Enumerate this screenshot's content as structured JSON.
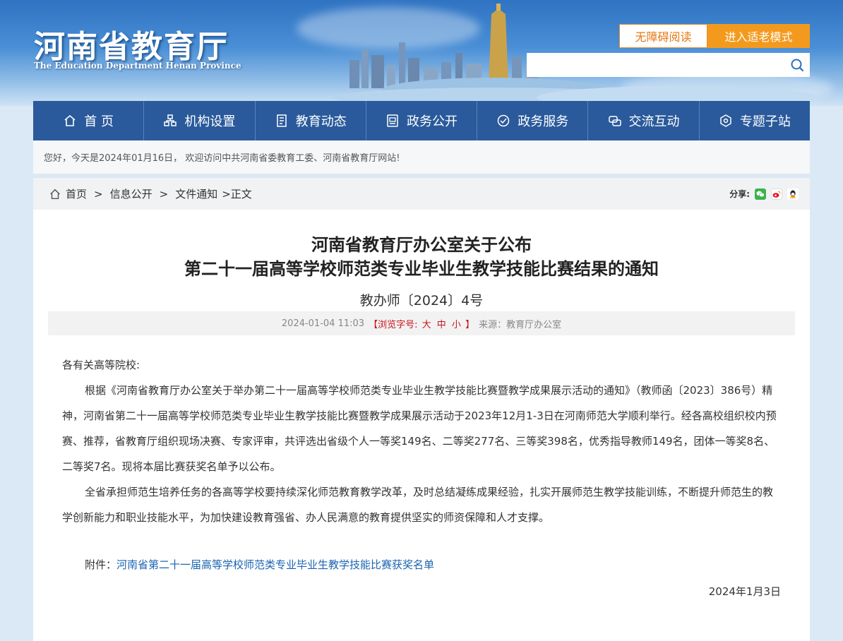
{
  "header": {
    "logo_cn": "河南省教育厅",
    "logo_en": "The Education Department Henan Province",
    "accessible_label": "无障碍阅读",
    "elder_mode_label": "进入适老模式",
    "search_placeholder": ""
  },
  "nav": {
    "items": [
      {
        "label": "首 页",
        "icon": "home-icon"
      },
      {
        "label": "机构设置",
        "icon": "org-icon"
      },
      {
        "label": "教育动态",
        "icon": "news-icon"
      },
      {
        "label": "政务公开",
        "icon": "gov-open-icon"
      },
      {
        "label": "政务服务",
        "icon": "service-icon"
      },
      {
        "label": "交流互动",
        "icon": "interact-icon"
      },
      {
        "label": "专题子站",
        "icon": "topic-icon"
      }
    ]
  },
  "welcome": "您好，今天是2024年01月16日， 欢迎访问中共河南省委教育工委、河南省教育厅网站!",
  "breadcrumb": {
    "home": "首页",
    "level1": "信息公开",
    "level2": "文件通知",
    "current": ">正文",
    "sep": ">"
  },
  "share": {
    "label": "分享:"
  },
  "article": {
    "title_line1": "河南省教育厅办公室关于公布",
    "title_line2": "第二十一届高等学校师范类专业毕业生教学技能比赛结果的通知",
    "doc_no": "教办师〔2024〕4号",
    "date": "2024-01-04 11:03",
    "font_label_open": "【浏览字号:",
    "font_large": "大",
    "font_medium": "中",
    "font_small": "小",
    "font_label_close": "】",
    "source": "来源：教育厅办公室",
    "salutation": "各有关高等院校:",
    "para1": "根据《河南省教育厅办公室关于举办第二十一届高等学校师范类专业毕业生教学技能比赛暨教学成果展示活动的通知》（教师函〔2023〕386号）精神，河南省第二十一届高等学校师范类专业毕业生教学技能比赛暨教学成果展示活动于2023年12月1-3日在河南师范大学顺利举行。经各高校组织校内预赛、推荐，省教育厅组织现场决赛、专家评审，共评选出省级个人一等奖149名、二等奖277名、三等奖398名，优秀指导教师149名，团体一等奖8名、二等奖7名。现将本届比赛获奖名单予以公布。",
    "para2": "全省承担师范生培养任务的各高等学校要持续深化师范教育教学改革，及时总结凝练成果经验，扎实开展师范生教学技能训练，不断提升师范生的教学创新能力和职业技能水平，为加快建设教育强省、办人民满意的教育提供坚实的师资保障和人才支撑。",
    "attachment_label": "附件：",
    "attachment_link": "河南省第二十一届高等学校师范类专业毕业生教学技能比赛获奖名单",
    "sign_date": "2024年1月3日"
  },
  "colors": {
    "nav_bg": "#2a5a9b",
    "accent_orange": "#f39a1e",
    "link_blue": "#1a64b0",
    "font_size_red": "#c8161d"
  }
}
